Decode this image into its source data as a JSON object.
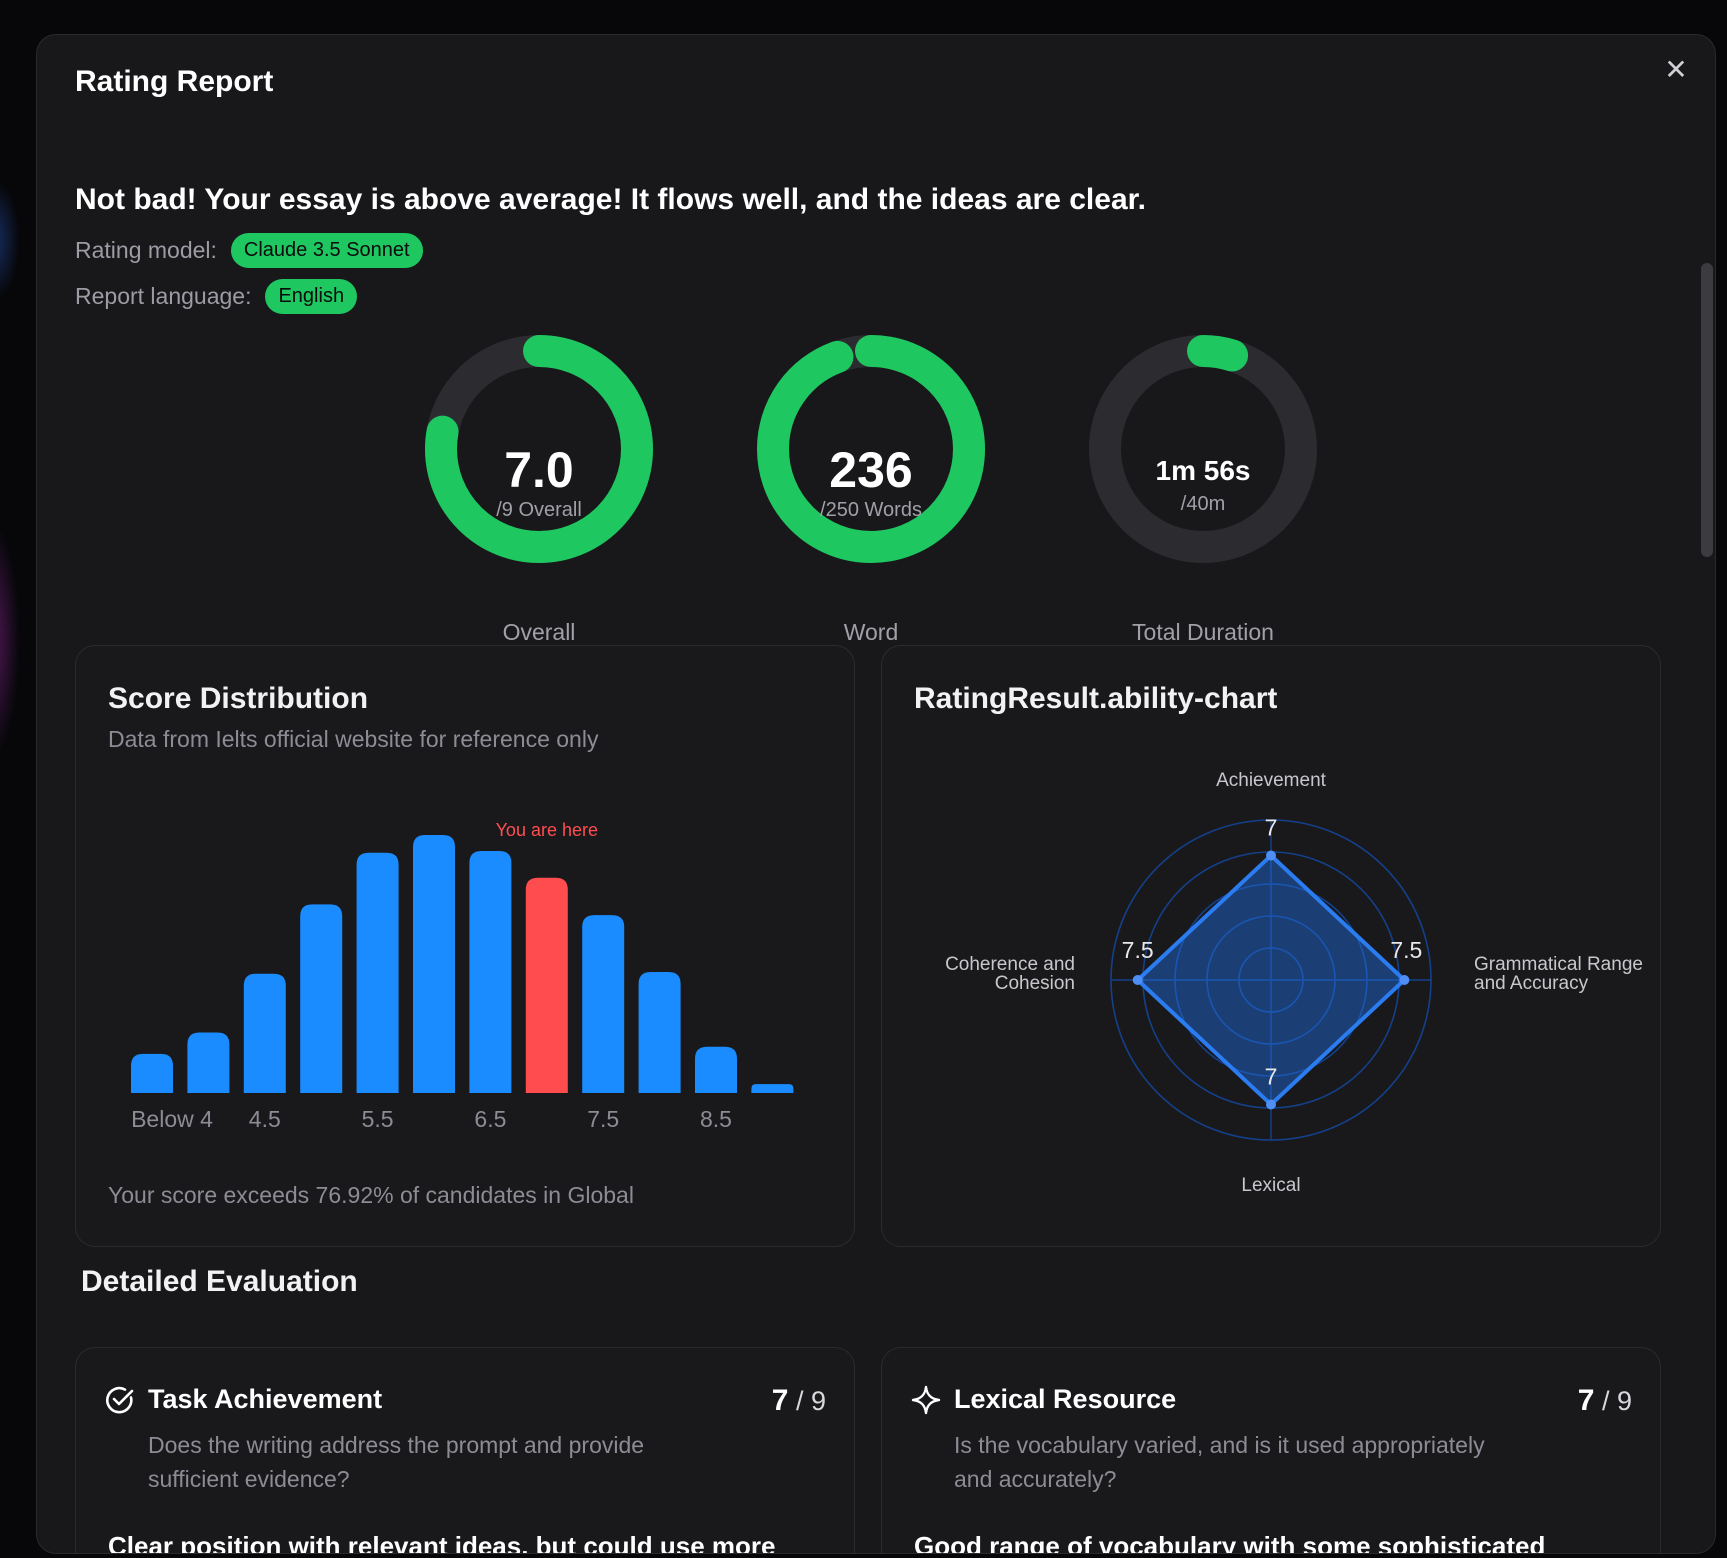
{
  "modal": {
    "title": "Rating Report",
    "close_icon": "close-icon",
    "headline": "Not bad! Your essay is above average! It flows well, and the ideas are clear.",
    "rating_model_label": "Rating model:",
    "rating_model_value": "Claude 3.5 Sonnet",
    "report_language_label": "Report language:",
    "report_language_value": "English"
  },
  "rings": [
    {
      "value": "7.0",
      "sub": "/9 Overall",
      "label": "Overall",
      "progress": 0.778
    },
    {
      "value": "236",
      "sub": "/250 Words",
      "label": "Word",
      "progress": 0.944
    },
    {
      "value": "1m 56s",
      "sub": "/40m",
      "label": "Total Duration",
      "progress": 0.048
    }
  ],
  "score_distribution": {
    "title": "Score Distribution",
    "subtitle": "Data from Ielts official website for reference only",
    "marker_label": "You are here",
    "footer": "Your score exceeds 76.92% of candidates in Global"
  },
  "ability_chart": {
    "title": "RatingResult.ability-chart"
  },
  "detailed": {
    "title": "Detailed Evaluation",
    "items": [
      {
        "icon": "check-circle-icon",
        "name": "Task Achievement",
        "score": "7",
        "max": "/ 9",
        "description": "Does the writing address the prompt and provide sufficient evidence?",
        "summary": "Clear position with relevant ideas, but could use more"
      },
      {
        "icon": "sparkle-icon",
        "name": "Lexical Resource",
        "score": "7",
        "max": "/ 9",
        "description": "Is the vocabulary varied, and is it used appropriately and accurately?",
        "summary": "Good range of vocabulary with some sophisticated"
      }
    ]
  },
  "colors": {
    "accent_green": "#1ec760",
    "bar_blue": "#1a8cff",
    "bar_highlight": "#ff4d4f",
    "radar_blue": "#1f6fe0"
  },
  "chart_data": [
    {
      "type": "bar",
      "title": "Score Distribution",
      "categories": [
        "Below 4",
        "4",
        "4.5",
        "5",
        "5.5",
        "6",
        "6.5",
        "7",
        "7.5",
        "8",
        "8.5",
        "9"
      ],
      "tick_labels": [
        "Below 4",
        "4.5",
        "5.5",
        "6.5",
        "7.5",
        "8.5"
      ],
      "values": [
        2.2,
        3.4,
        6.7,
        10.6,
        13.5,
        14.5,
        13.6,
        12.1,
        10.0,
        6.8,
        2.6,
        0.5
      ],
      "highlight_category": "7",
      "grid": false
    },
    {
      "type": "radar",
      "title": "RatingResult.ability-chart",
      "axes": [
        "Achievement",
        "Grammatical Range and Accuracy",
        "Lexical",
        "Coherence and Cohesion"
      ],
      "axis_label_lines": [
        [
          "Achievement"
        ],
        [
          "Grammatical Range",
          "and Accuracy"
        ],
        [
          "Lexical"
        ],
        [
          "Coherence and",
          "Cohesion"
        ]
      ],
      "values": [
        7,
        7.5,
        7,
        7.5
      ],
      "value_labels": [
        "7",
        "7.5",
        "7",
        "7.5"
      ],
      "range": [
        0,
        9
      ],
      "rings": 5
    }
  ]
}
